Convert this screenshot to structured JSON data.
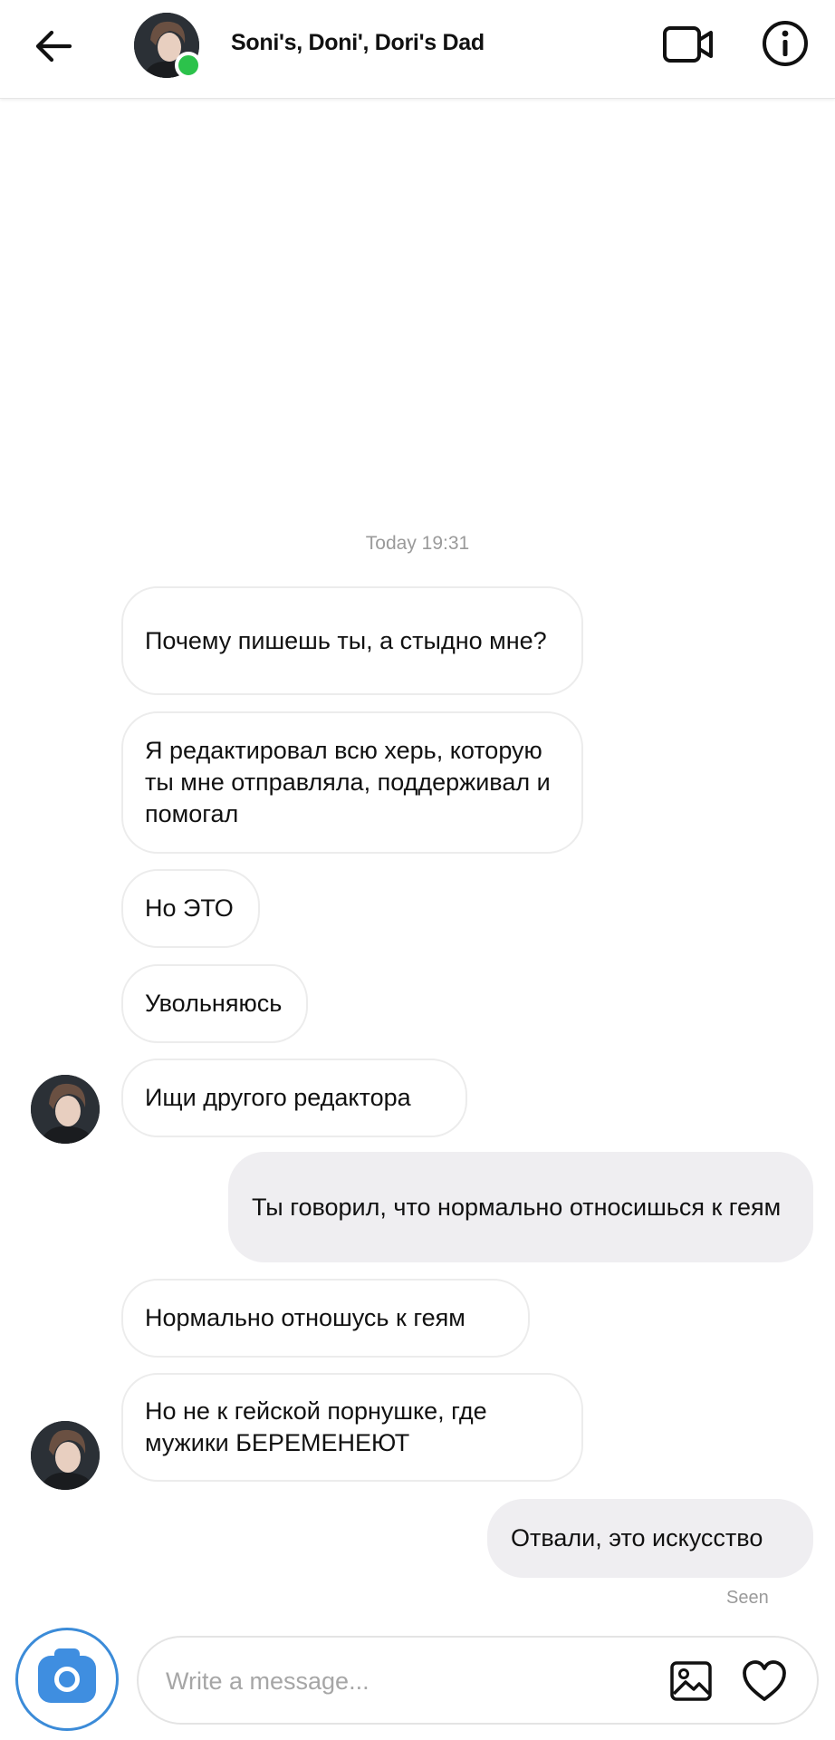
{
  "header": {
    "back_icon": "arrow-left-icon",
    "title": "Soni's, Doni', Dori's Dad",
    "online": true,
    "video_icon": "video-camera-icon",
    "info_icon": "info-icon"
  },
  "conversation": {
    "timestamp": "Today 19:31",
    "messages": [
      {
        "from": "them",
        "text": "Почему пишешь ты, а стыдно мне?"
      },
      {
        "from": "them",
        "text": "Я редактировал всю херь, которую ты мне отправляла, поддерживал и помогал"
      },
      {
        "from": "them",
        "text": "Но ЭТО"
      },
      {
        "from": "them",
        "text": "Увольняюсь"
      },
      {
        "from": "them",
        "text": "Ищи другого редактора"
      },
      {
        "from": "me",
        "text": "Ты говорил, что нормально относишься к геям"
      },
      {
        "from": "them",
        "text": "Нормально отношусь к геям"
      },
      {
        "from": "them",
        "text": "Но не к гейской порнушке, где мужики БЕРЕМЕНЕЮТ"
      },
      {
        "from": "me",
        "text": "Отвали, это искусство"
      }
    ],
    "seen_label": "Seen"
  },
  "composer": {
    "camera_icon": "camera-icon",
    "placeholder": "Write a message...",
    "value": "",
    "gallery_icon": "image-icon",
    "heart_icon": "heart-icon"
  },
  "colors": {
    "online": "#2cc24b",
    "accent": "#3f8ee0",
    "outgoing_bubble": "#efeef1",
    "incoming_border": "#ececec"
  }
}
